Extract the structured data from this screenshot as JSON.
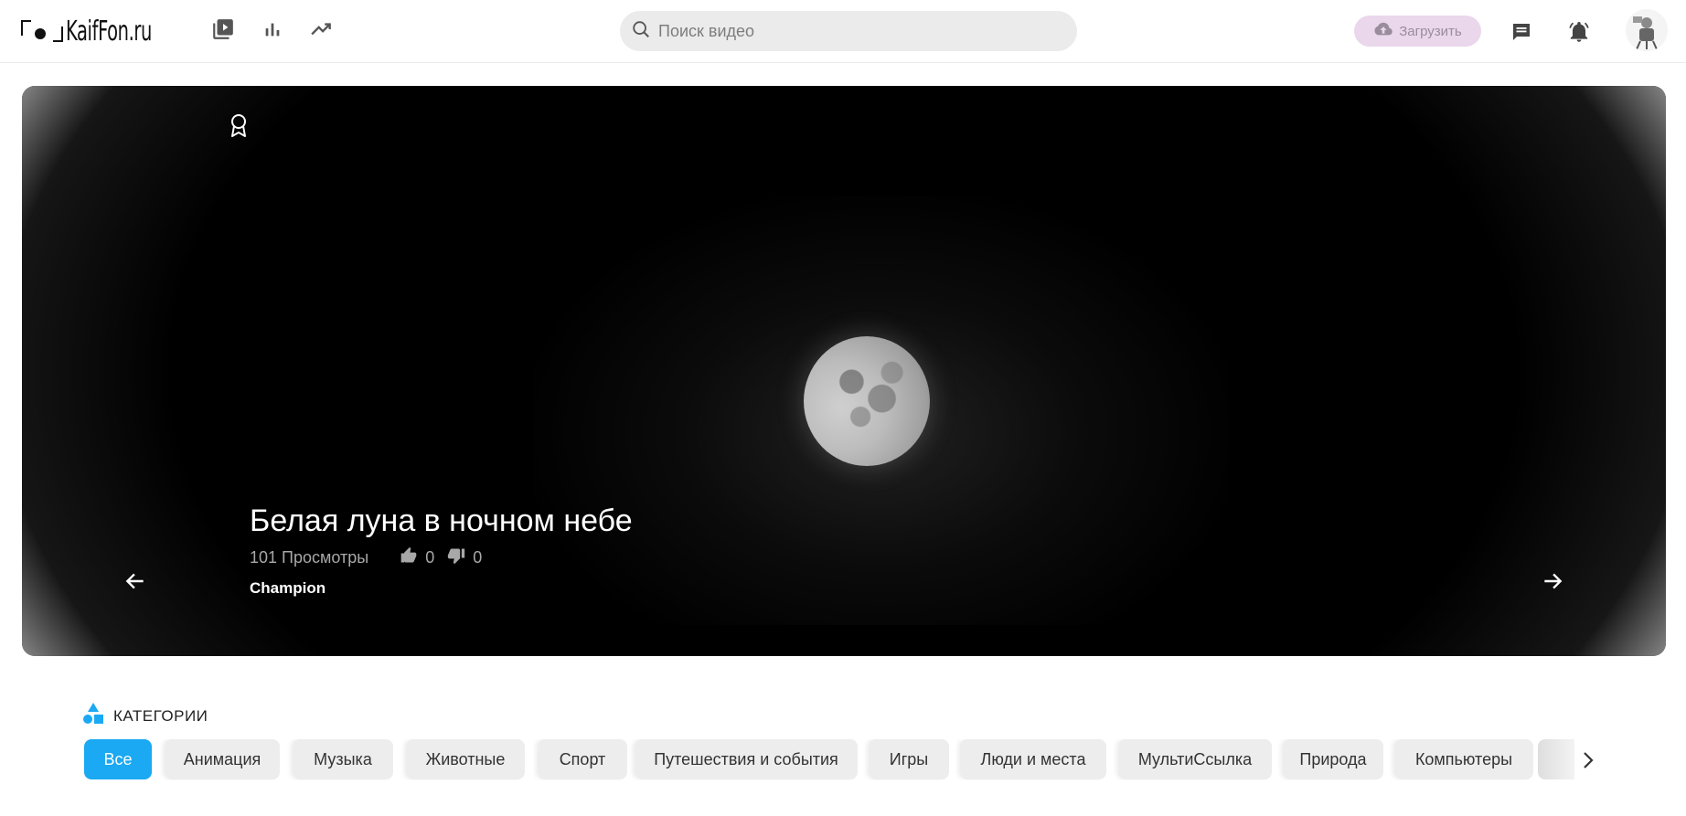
{
  "header": {
    "logo_text": "KaifFon.ru",
    "search": {
      "placeholder": "Поиск видео",
      "value": ""
    },
    "upload_label": "Загрузить",
    "nav_icons": [
      "video-library-icon",
      "bar-chart-icon",
      "trending-icon"
    ],
    "right_icons": [
      "cloud-upload-icon",
      "message-icon",
      "bell-icon",
      "avatar"
    ]
  },
  "hero": {
    "title": "Белая луна в ночном небе",
    "views": "101 Просмотры",
    "likes": "0",
    "dislikes": "0",
    "author": "Champion",
    "badge_icon": "award-icon",
    "prev_icon": "arrow-left-icon",
    "next_icon": "arrow-right-icon"
  },
  "categories": {
    "title": "КАТЕГОРИИ",
    "icon": "shapes-icon",
    "active_color": "#1aa9f2",
    "items": [
      {
        "label": "Все",
        "active": true
      },
      {
        "label": "Анимация",
        "active": false
      },
      {
        "label": "Музыка",
        "active": false
      },
      {
        "label": "Животные",
        "active": false
      },
      {
        "label": "Спорт",
        "active": false
      },
      {
        "label": "Путешествия и события",
        "active": false
      },
      {
        "label": "Игры",
        "active": false
      },
      {
        "label": "Люди и места",
        "active": false
      },
      {
        "label": "МультиСсылка",
        "active": false
      },
      {
        "label": "Природа",
        "active": false
      },
      {
        "label": "Компьютеры",
        "active": false
      }
    ]
  }
}
